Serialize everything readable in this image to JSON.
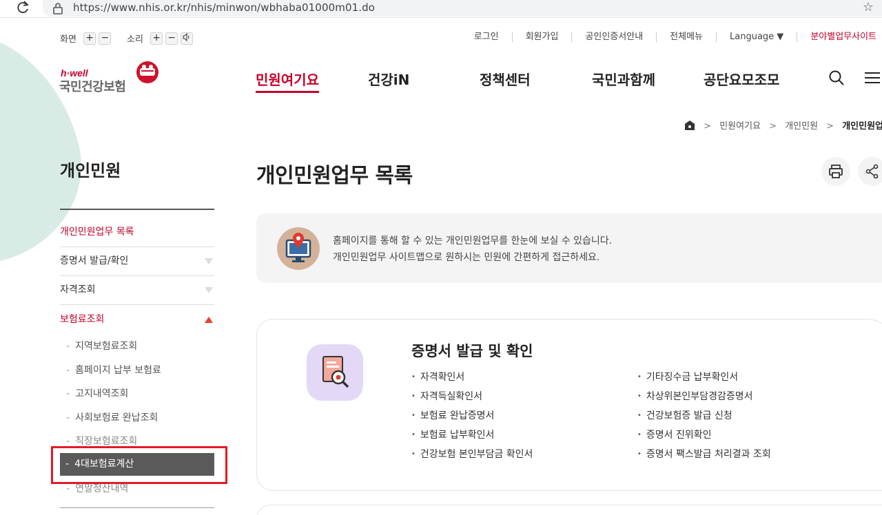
{
  "browser": {
    "url": "https://www.nhis.or.kr/nhis/minwon/wbhaba01000m01.do"
  },
  "utility": {
    "screen_label": "화면",
    "sound_label": "소리",
    "plus": "+",
    "minus": "−"
  },
  "top_links": [
    "로그인",
    "회원가입",
    "공인인증서안내",
    "전체메뉴",
    "Language ▼",
    "분야별업무사이트"
  ],
  "logo": {
    "hwell": "h·well",
    "name": "국민건강보험"
  },
  "gnb": [
    "민원여기요",
    "건강iN",
    "정책센터",
    "국민과함께",
    "공단요모조모"
  ],
  "breadcrumb": {
    "level1": "민원여기요",
    "level2": "개인민원",
    "current": "개인민원업무 목록"
  },
  "sidebar": {
    "title": "개인민원",
    "items": [
      {
        "label": "개인민원업무 목록"
      },
      {
        "label": "증명서 발급/확인"
      },
      {
        "label": "자격조회"
      },
      {
        "label": "보험료조회"
      }
    ],
    "sub_items": [
      {
        "label": "지역보험료조회"
      },
      {
        "label": "홈페이지 납부 보험료"
      },
      {
        "label": "고지내역조회"
      },
      {
        "label": "사회보험료 완납조회"
      },
      {
        "label": "직장보험료조회"
      },
      {
        "label": "4대보험료계산"
      },
      {
        "label": "연말정산내역"
      }
    ],
    "dash": "-"
  },
  "main": {
    "title": "개인민원업무 목록",
    "notice_line1": "홈페이지를 통해 할 수 있는 개인민원업무를 한눈에 보실 수 있습니다.",
    "notice_line2": "개인민원업무 사이트맵으로 원하시는 민원에 간편하게 접근하세요.",
    "card": {
      "title": "증명서 발급 및 확인",
      "left": [
        "자격확인서",
        "자격득실확인서",
        "보험료 완납증명서",
        "보험료 납부확인서",
        "건강보험 본인부담금 확인서"
      ],
      "right": [
        "기타징수금 납부확인서",
        "차상위본인부담경감증명서",
        "건강보험증 발급 신청",
        "증명서 진위확인",
        "증명서 팩스발급 처리결과 조회"
      ]
    }
  },
  "colors": {
    "brand_red": "#c5002a",
    "highlight_outline": "#e11b25",
    "selected_bg": "#5a5a5a"
  },
  "icons": {
    "reload": "reload-icon",
    "lock": "lock-icon",
    "star": "star-icon",
    "sound": "speaker-icon",
    "search": "search-icon",
    "menu": "hamburger-menu-icon",
    "home": "home-icon",
    "print": "print-icon",
    "share": "share-icon",
    "notice": "monitor-location-icon",
    "card": "document-search-icon"
  }
}
